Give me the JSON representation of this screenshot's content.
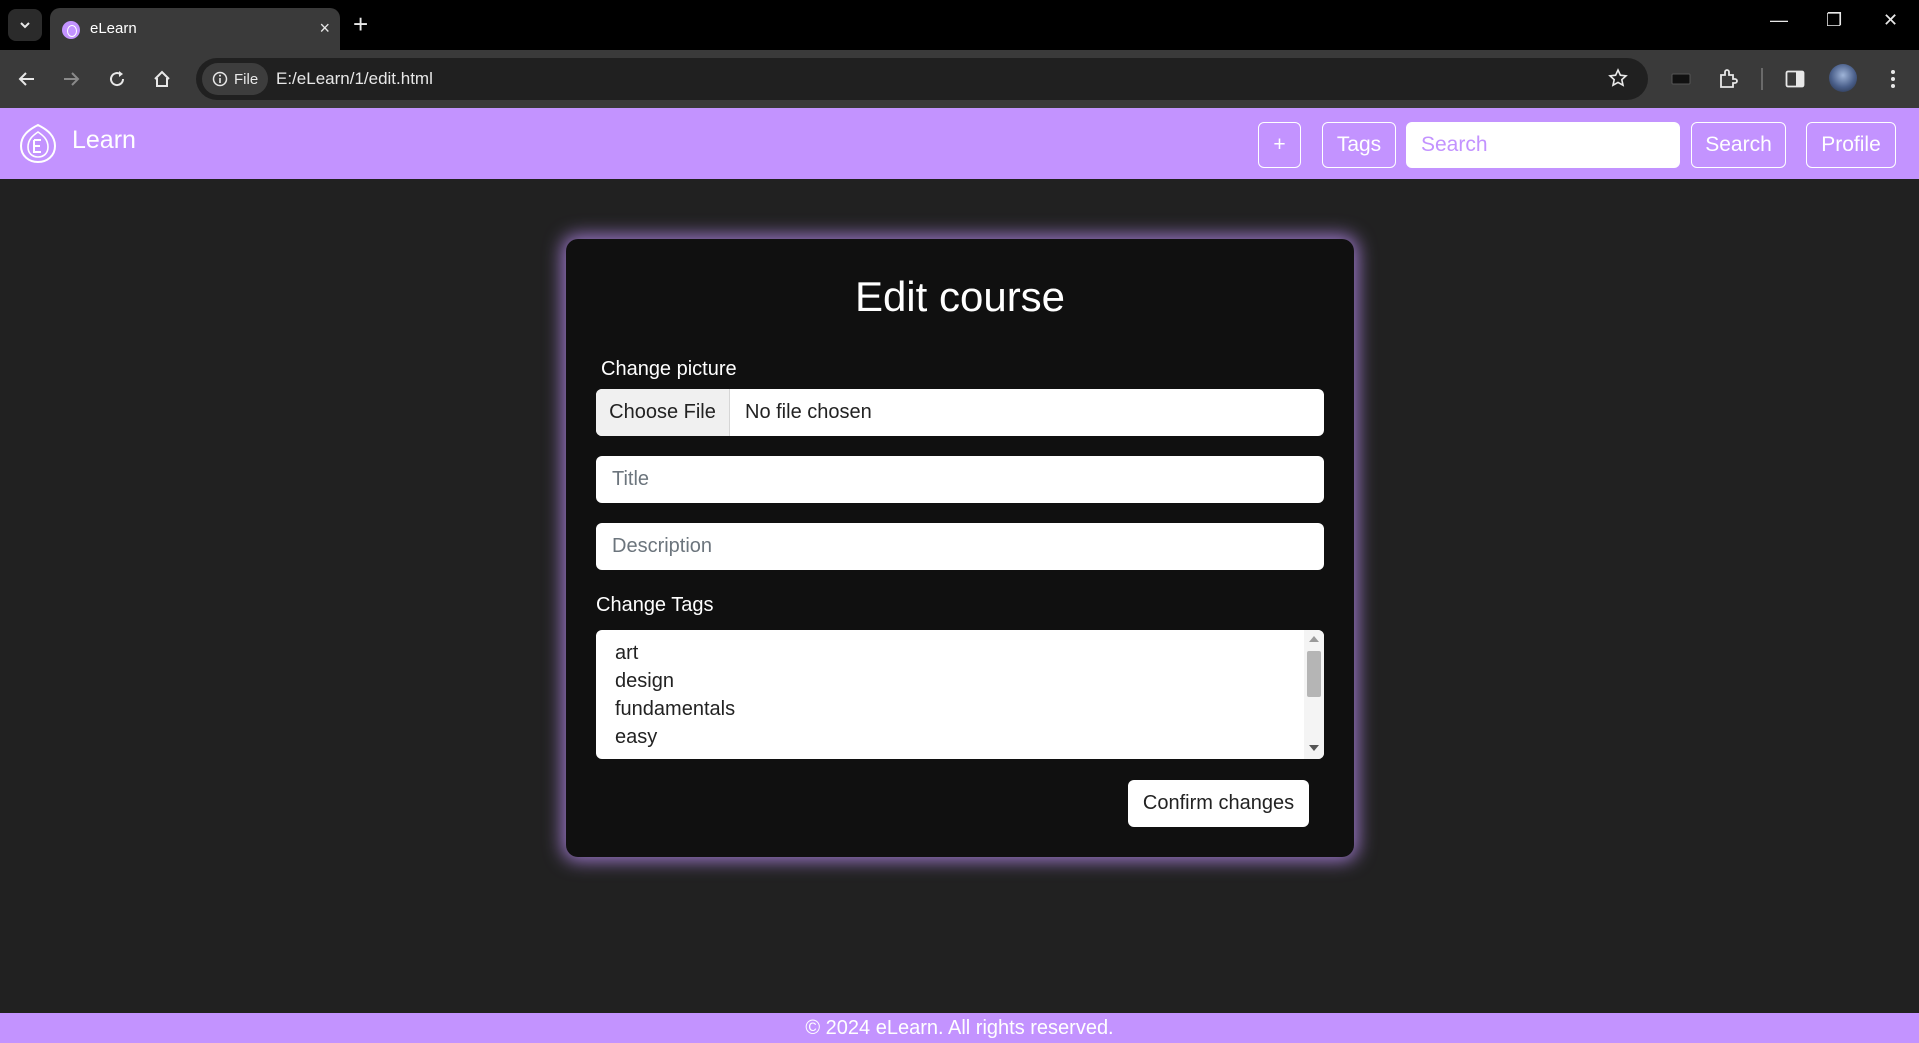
{
  "browser": {
    "tab_title": "eLearn",
    "tab_close": "×",
    "new_tab": "+",
    "site_info_label": "File",
    "url": "E:/eLearn/1/edit.html",
    "window_controls": {
      "minimize": "—",
      "restore": "❐",
      "close": "✕"
    }
  },
  "nav": {
    "brand": "Learn",
    "add_label": "+",
    "tags_label": "Tags",
    "search_placeholder": "Search",
    "search_button": "Search",
    "profile_label": "Profile",
    "accent_color": "#c393ff"
  },
  "form": {
    "title": "Edit course",
    "picture_label": "Change picture",
    "file_button": "Choose File",
    "file_status": "No file chosen",
    "title_placeholder": "Title",
    "description_placeholder": "Description",
    "tags_label": "Change Tags",
    "tags": [
      "art",
      "design",
      "fundamentals",
      "easy"
    ],
    "confirm_button": "Confirm changes"
  },
  "footer": {
    "text": "© 2024 eLearn. All rights reserved."
  },
  "icons": [
    "tab-list-icon",
    "favicon-icon",
    "close-icon",
    "new-tab-icon",
    "back-icon",
    "forward-icon",
    "reload-icon",
    "home-icon",
    "info-icon",
    "star-icon",
    "card-icon",
    "extensions-icon",
    "side-panel-icon",
    "profile-avatar",
    "menu-icon",
    "logo-icon"
  ]
}
